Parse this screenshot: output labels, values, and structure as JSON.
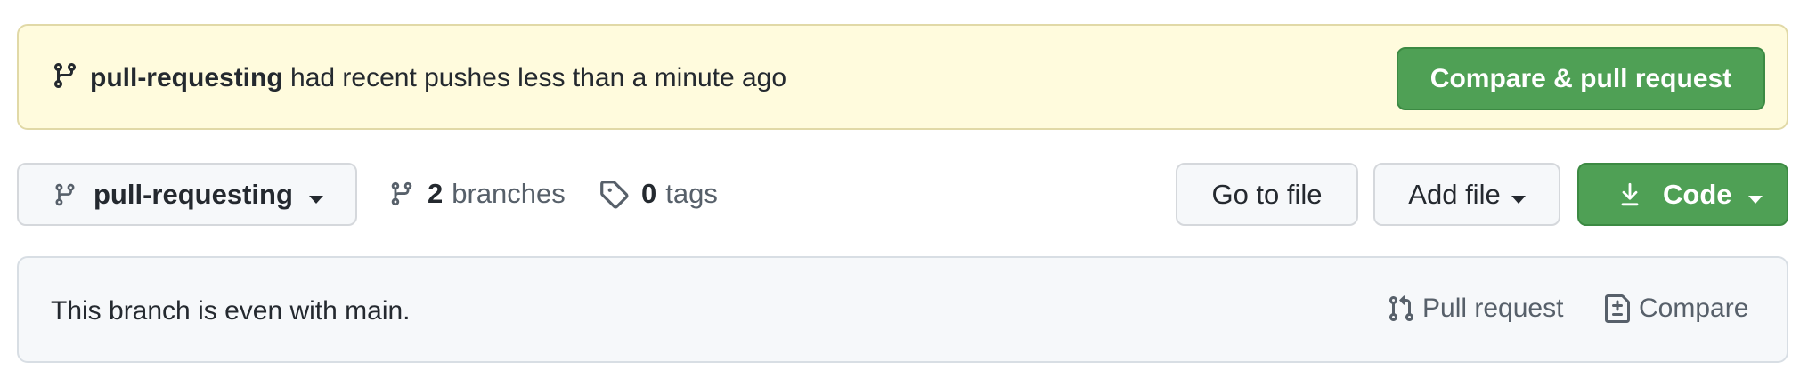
{
  "banner": {
    "branch_name": "pull-requesting",
    "message": " had recent pushes less than a minute ago",
    "compare_button_label": "Compare & pull request",
    "icon": "git-branch-icon"
  },
  "toolbar": {
    "branch_select": {
      "label": "pull-requesting",
      "icon": "git-branch-icon"
    },
    "branches": {
      "count": "2",
      "label": "branches",
      "icon": "git-branch-icon"
    },
    "tags": {
      "count": "0",
      "label": "tags",
      "icon": "tag-icon"
    },
    "go_to_file_label": "Go to file",
    "add_file_label": "Add file",
    "code_label": "Code"
  },
  "status": {
    "message": "This branch is even with main.",
    "pull_request_label": "Pull request",
    "compare_label": "Compare"
  },
  "colors": {
    "banner_bg": "#fffbdd",
    "primary_green": "#4fa055",
    "button_bg": "#f6f8fa",
    "muted_text": "#57606a",
    "text": "#24292f"
  }
}
